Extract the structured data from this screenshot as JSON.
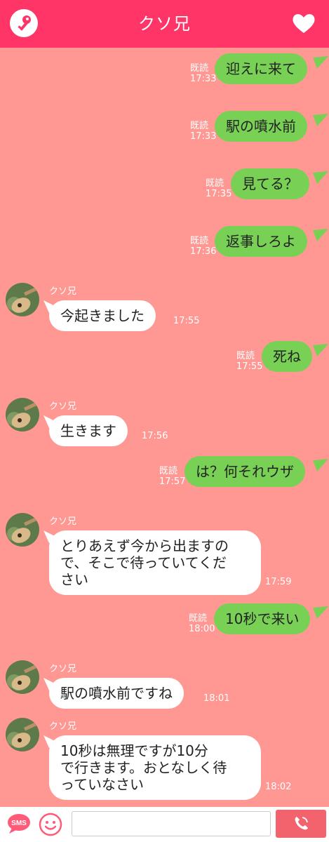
{
  "header": {
    "title": "クソ兄",
    "key_icon": "key-icon",
    "heart_icon": "heart-icon"
  },
  "colors": {
    "header": "#ff3568",
    "background": "#ff9893",
    "sent_bubble": "#78d055",
    "received_bubble": "#ffffff",
    "call_button": "#f3636d"
  },
  "messages": [
    {
      "dir": "out",
      "text": "迎えに来て",
      "read": "既読",
      "time": "17:33"
    },
    {
      "dir": "out",
      "text": "駅の噴水前",
      "read": "既読",
      "time": "17:33"
    },
    {
      "dir": "out",
      "text": "見てる？",
      "read": "既読",
      "time": "17:35"
    },
    {
      "dir": "out",
      "text": "返事しろよ",
      "read": "既読",
      "time": "17:36"
    },
    {
      "dir": "in",
      "sender": "クソ兄",
      "text": "今起きました",
      "time": "17:55"
    },
    {
      "dir": "out",
      "text": "死ね",
      "read": "既読",
      "time": "17:55"
    },
    {
      "dir": "in",
      "sender": "クソ兄",
      "text": "生きます",
      "time": "17:56"
    },
    {
      "dir": "out",
      "text": "は？何それウザ",
      "read": "既読",
      "time": "17:57"
    },
    {
      "dir": "in",
      "sender": "クソ兄",
      "text": "とりあえず今から出ますの\nで、そこで待っていてくだ\nさい",
      "time": "17:59"
    },
    {
      "dir": "out",
      "text": "10秒で来い",
      "read": "既読",
      "time": "18:00"
    },
    {
      "dir": "in",
      "sender": "クソ兄",
      "text": "駅の噴水前ですね",
      "time": "18:01"
    },
    {
      "dir": "in",
      "sender": "クソ兄",
      "text": "10秒は無理ですが10分\nで行きます。おとなしく待\nっていなさい",
      "time": "18:02"
    }
  ],
  "footer": {
    "sms_label": "SMS",
    "smile_icon": "smile-icon",
    "message_input_value": "",
    "call_icon": "phone-icon"
  }
}
